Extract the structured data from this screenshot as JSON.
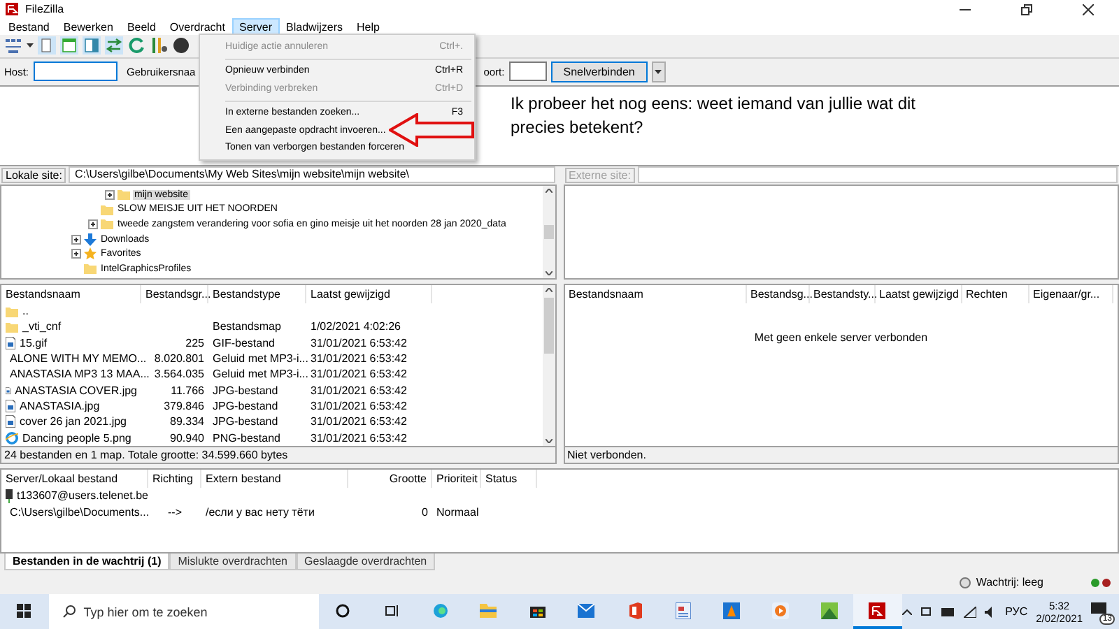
{
  "window": {
    "title": "FileZilla"
  },
  "menu_bar": [
    {
      "label": "Bestand",
      "selected": false
    },
    {
      "label": "Bewerken",
      "selected": false
    },
    {
      "label": "Beeld",
      "selected": false
    },
    {
      "label": "Overdracht",
      "selected": false
    },
    {
      "label": "Server",
      "selected": true
    },
    {
      "label": "Bladwijzers",
      "selected": false
    },
    {
      "label": "Help",
      "selected": false
    }
  ],
  "server_menu": [
    {
      "kind": "item",
      "label": "Huidige actie annuleren",
      "shortcut": "Ctrl+.",
      "disabled": true
    },
    {
      "kind": "separator"
    },
    {
      "kind": "item",
      "label": "Opnieuw verbinden",
      "shortcut": "Ctrl+R",
      "disabled": false
    },
    {
      "kind": "item",
      "label": "Verbinding verbreken",
      "shortcut": "Ctrl+D",
      "disabled": true
    },
    {
      "kind": "separator"
    },
    {
      "kind": "item",
      "label": "In externe bestanden zoeken...",
      "shortcut": "F3",
      "disabled": false
    },
    {
      "kind": "item",
      "label": "Een aangepaste opdracht invoeren...",
      "disabled": false
    },
    {
      "kind": "item",
      "label": "Tonen van verborgen bestanden forceren",
      "disabled": false
    }
  ],
  "quickconnect": {
    "host_label": "Host:",
    "user_label": "Gebruikersnaa",
    "port_label": "oort:",
    "button": "Snelverbinden"
  },
  "annotation": {
    "text": "Ik probeer het nog eens:  weet iemand van jullie wat dit precies betekent?"
  },
  "local_site": {
    "label": "Lokale site:",
    "path": "C:\\Users\\gilbe\\Documents\\My Web Sites\\mijn website\\mijn website\\"
  },
  "remote_site": {
    "label": "Externe site:"
  },
  "tree": [
    {
      "children": [
        {
          "children": [
            {
              "label": "mijn website",
              "kind": "folder",
              "expandable": true,
              "selected": true
            }
          ]
        },
        {
          "label": "SLOW MEISJE UIT HET NOORDEN",
          "kind": "folder",
          "expandable": false,
          "selected": false
        },
        {
          "label": "tweede zangstem verandering voor sofia en gino meisje uit het noorden 28 jan 2020_data",
          "kind": "folder",
          "expandable": true,
          "selected": false
        }
      ]
    },
    {
      "label": "Downloads",
      "kind": "download",
      "expandable": true,
      "selected": false
    },
    {
      "label": "Favorites",
      "kind": "star",
      "expandable": true,
      "selected": false
    },
    {
      "label": "IntelGraphicsProfiles",
      "kind": "folder",
      "expandable": false,
      "selected": false
    }
  ],
  "local_files": {
    "columns": [
      "Bestandsnaam",
      "Bestandsgr...",
      "Bestandstype",
      "Laatst gewijzigd"
    ],
    "rows": [
      {
        "kind": "folder",
        "name": ".."
      },
      {
        "kind": "folder",
        "name": "_vti_cnf",
        "type": "Bestandsmap",
        "modified": "1/02/2021 4:02:26"
      },
      {
        "kind": "image",
        "name": "15.gif",
        "size": "225",
        "type": "GIF-bestand",
        "modified": "31/01/2021 6:53:42"
      },
      {
        "kind": "audio",
        "name": "ALONE WITH MY MEMO...",
        "size": "8.020.801",
        "type": "Geluid met MP3-i...",
        "modified": "31/01/2021 6:53:42"
      },
      {
        "kind": "audio",
        "name": "ANASTASIA  MP3 13 MAA...",
        "size": "3.564.035",
        "type": "Geluid met MP3-i...",
        "modified": "31/01/2021 6:53:42"
      },
      {
        "kind": "image",
        "name": "ANASTASIA COVER.jpg",
        "size": "11.766",
        "type": "JPG-bestand",
        "modified": "31/01/2021 6:53:42"
      },
      {
        "kind": "image",
        "name": "ANASTASIA.jpg",
        "size": "379.846",
        "type": "JPG-bestand",
        "modified": "31/01/2021 6:53:42"
      },
      {
        "kind": "image",
        "name": "cover 26 jan 2021.jpg",
        "size": "89.334",
        "type": "JPG-bestand",
        "modified": "31/01/2021 6:53:42"
      },
      {
        "kind": "browser",
        "name": "Dancing people 5.png",
        "size": "90.940",
        "type": "PNG-bestand",
        "modified": "31/01/2021 6:53:42"
      }
    ],
    "status": "24 bestanden en 1 map. Totale grootte: 34.599.660 bytes"
  },
  "remote_files": {
    "columns": [
      "Bestandsnaam",
      "Bestandsg...",
      "Bestandsty...",
      "Laatst gewijzigd",
      "Rechten",
      "Eigenaar/gr..."
    ],
    "empty_message": "Met geen enkele server verbonden",
    "status": "Niet verbonden."
  },
  "queue": {
    "columns": [
      "Server/Lokaal bestand",
      "Richting",
      "Extern bestand",
      "Grootte",
      "Prioriteit",
      "Status"
    ],
    "rows": [
      {
        "kind": "server",
        "server": "t133607@users.telenet.be"
      },
      {
        "kind": "file",
        "local": "C:\\Users\\gilbe\\Documents...",
        "direction": "-->",
        "remote": "/если у вас нету тёти",
        "size": "0",
        "priority": "Normaal"
      }
    ]
  },
  "queue_tabs": [
    {
      "label": "Bestanden in de wachtrij (1)",
      "selected": true
    },
    {
      "label": "Mislukte overdrachten",
      "selected": false
    },
    {
      "label": "Geslaagde overdrachten",
      "selected": false
    }
  ],
  "status_bar": {
    "queue": "Wachtrij: leeg"
  },
  "taskbar": {
    "search_placeholder": "Typ hier om te zoeken",
    "language": "РУС",
    "time": "5:32",
    "date": "2/02/2021",
    "notifications": "13"
  }
}
